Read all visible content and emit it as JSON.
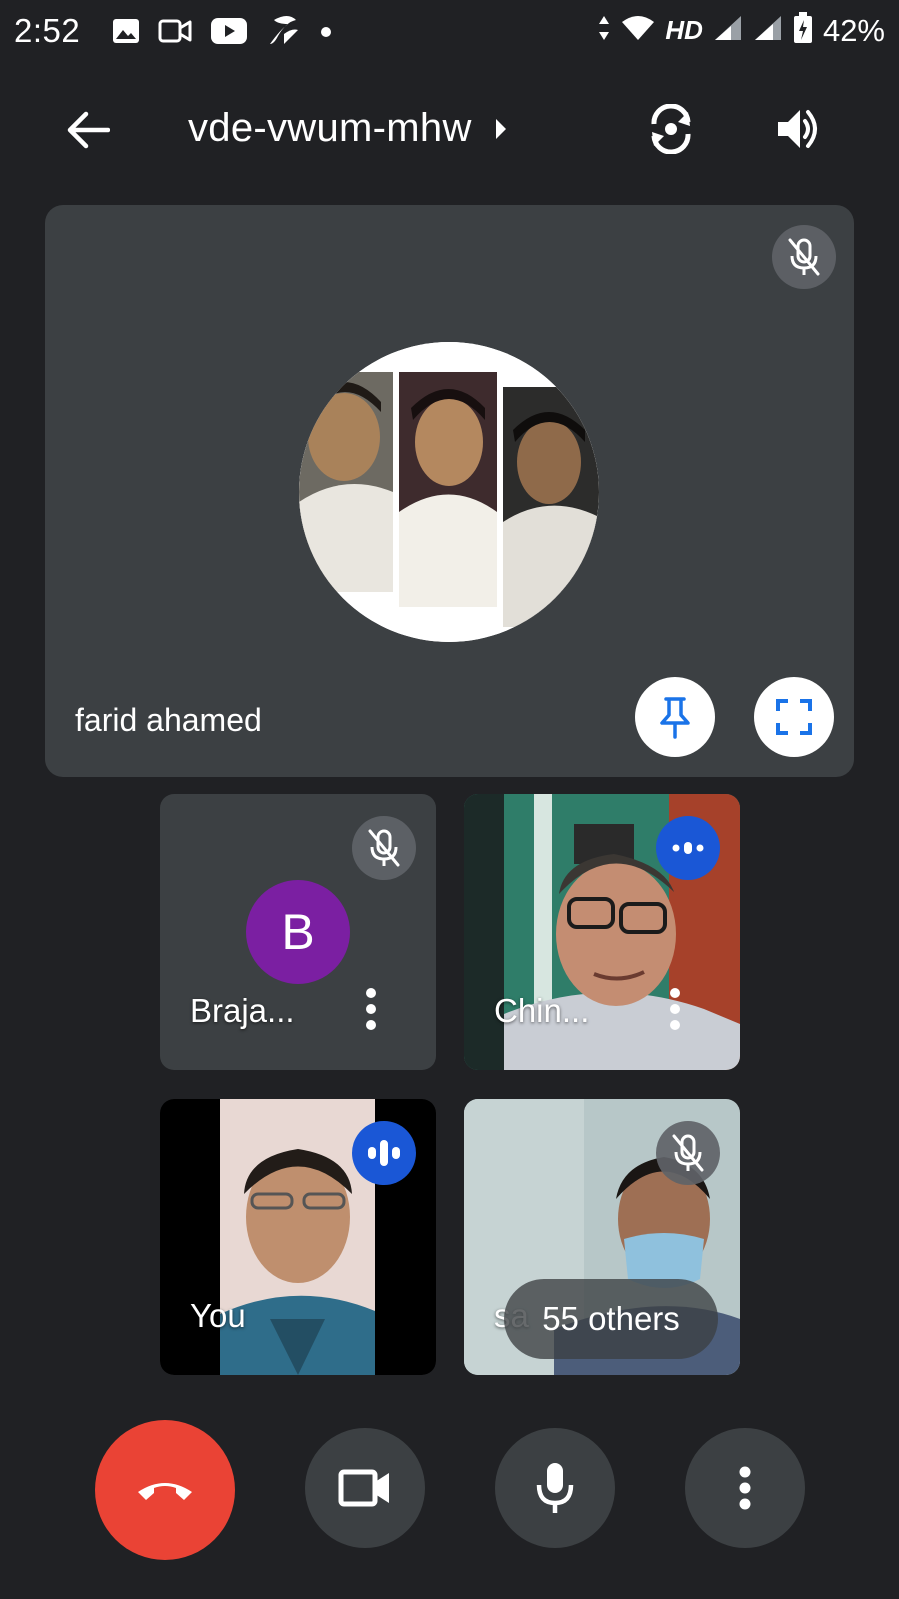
{
  "status_bar": {
    "time": "2:52",
    "network": "HD",
    "battery": "42%",
    "icons_left": [
      "gallery-icon",
      "video-icon",
      "youtube-icon",
      "app-icon",
      "dot-icon"
    ],
    "icons_right": [
      "data-arrows-icon",
      "wifi-icon",
      "signal-icon",
      "signal-icon",
      "battery-icon"
    ]
  },
  "top_bar": {
    "meeting_code": "vde-vwum-mhw",
    "icons": [
      "back-arrow-icon",
      "caret-right-icon",
      "switch-camera-icon",
      "speaker-icon"
    ]
  },
  "main_tile": {
    "name": "farid ahamed",
    "muted": true,
    "actions": [
      "pin-icon",
      "fullscreen-icon"
    ]
  },
  "participants": [
    {
      "name": "Braja...",
      "avatar_letter": "B",
      "avatar_color": "#7b1fa2",
      "muted": true
    },
    {
      "name": "Chin...",
      "status": "speaking",
      "muted": false
    },
    {
      "name": "You",
      "status": "speaking",
      "muted": false
    },
    {
      "name": "sa",
      "muted": true,
      "overlay": "55 others"
    }
  ],
  "controls": {
    "end_call_color": "#ea4335",
    "buttons": [
      "end-call-icon",
      "camera-icon",
      "mic-icon",
      "more-options-icon"
    ]
  },
  "colors": {
    "background": "#202124",
    "tile": "#3c4043",
    "accent_blue": "#1a57d6"
  }
}
